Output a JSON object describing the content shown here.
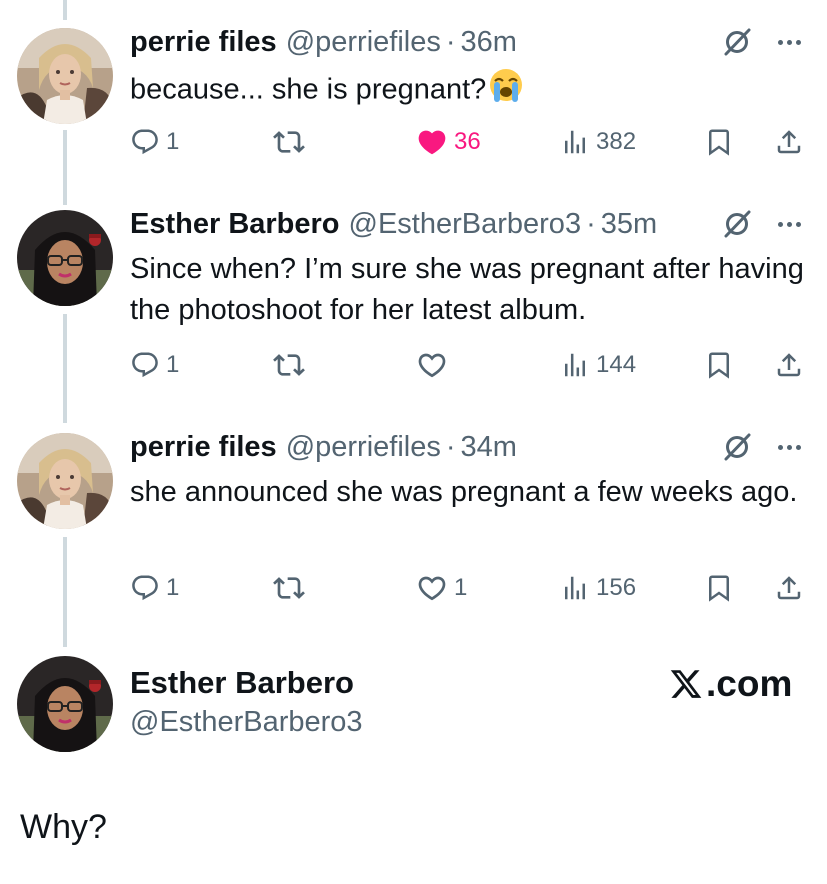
{
  "tweets": [
    {
      "name": "perrie files",
      "handle": "@perriefiles",
      "dot": "·",
      "time": "36m",
      "text": "because... she is pregnant?",
      "emoji_icon": "loudly-crying-face-emoji",
      "replies": "1",
      "likes": "36",
      "liked": true,
      "views": "382"
    },
    {
      "name": "Esther Barbero",
      "handle": "@EstherBarbero3",
      "dot": "·",
      "time": "35m",
      "text": "Since when? I’m sure she was pregnant after having the photoshoot for her latest album.",
      "replies": "1",
      "likes": "",
      "liked": false,
      "views": "144"
    },
    {
      "name": "perrie files",
      "handle": "@perriefiles",
      "dot": "·",
      "time": "34m",
      "text": "she announced she was pregnant a few weeks ago.",
      "replies": "1",
      "likes": "1",
      "liked": false,
      "views": "156"
    }
  ],
  "card": {
    "name": "Esther Barbero",
    "handle": "@EstherBarbero3",
    "brand": ".com"
  },
  "caption": "Why?",
  "colors": {
    "text": "#0f1419",
    "secondary": "#536471",
    "like": "#f91880",
    "thread_line": "#cfd9de"
  },
  "icons": [
    "reply-icon",
    "retweet-icon",
    "heart-icon",
    "views-icon",
    "bookmark-icon",
    "share-icon",
    "mute-conversation-icon",
    "more-icon",
    "x-logo-icon"
  ]
}
